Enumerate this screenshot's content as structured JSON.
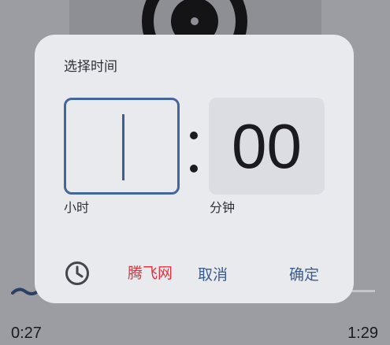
{
  "dialog": {
    "title": "选择时间",
    "hour_label": "小时",
    "minute_label": "分钟",
    "hour_value": "",
    "minute_value": "00",
    "separator": ":",
    "cancel_label": "取消",
    "ok_label": "确定",
    "mode_icon": "clock-icon",
    "watermark": "腾飞网"
  },
  "player": {
    "elapsed": "0:27",
    "total": "1:29"
  },
  "colors": {
    "accent": "#45669a",
    "watermark": "#e0333d",
    "dialog_bg": "#e9eaee",
    "scrim": "#9c9da3"
  }
}
